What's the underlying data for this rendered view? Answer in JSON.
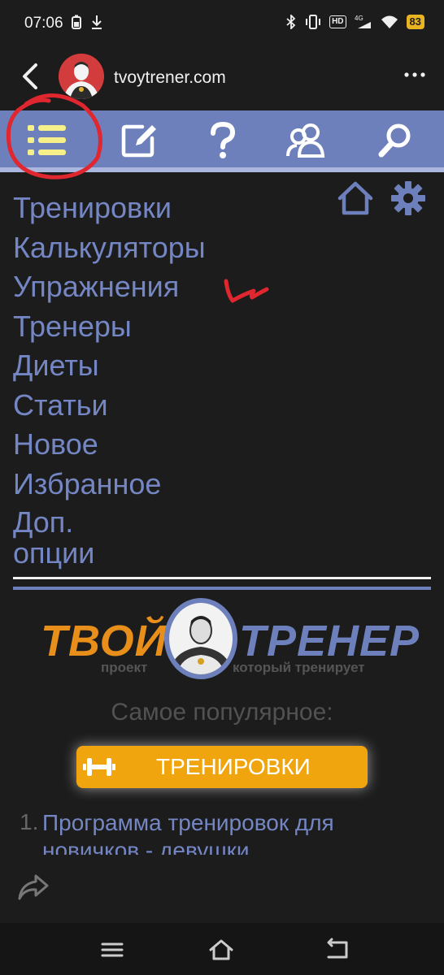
{
  "status_bar": {
    "time": "07:06",
    "network": "4G",
    "hd": "HD",
    "battery": "83"
  },
  "browser": {
    "site": "tvoytrener.com"
  },
  "toolbar": {
    "icons": [
      "menu-list-icon",
      "edit-icon",
      "help-icon",
      "users-icon",
      "search-icon"
    ]
  },
  "menu": {
    "items": [
      "Тренировки",
      "Калькуляторы",
      "Упражнения",
      "Тренеры",
      "Диеты",
      "Статьи",
      "Новое",
      "Избранное",
      "Доп. опции"
    ]
  },
  "logo": {
    "left_word": "ТВОЙ",
    "right_word": "ТРЕНЕР",
    "left_sub": "проект",
    "right_sub": "который тренирует"
  },
  "popular": {
    "heading": "Самое популярное:",
    "button_label": "ТРЕНИРОВКИ",
    "article_number": "1.",
    "article_text": "Программа тренировок для новичков - девушки"
  },
  "colors": {
    "accent_blue": "#6d80bc",
    "link_blue": "#7487c4",
    "orange": "#f0a50e",
    "annotation_red": "#e0262e",
    "highlight_yellow": "#f5f08a"
  }
}
